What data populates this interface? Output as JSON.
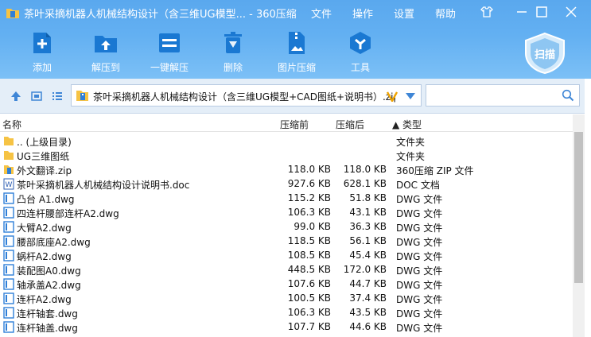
{
  "window": {
    "title": "茶叶采摘机器人机械结构设计（含三维UG模型... - 360压缩",
    "menu": [
      "文件",
      "操作",
      "设置",
      "帮助"
    ]
  },
  "toolbar": {
    "add": "添加",
    "extract": "解压到",
    "one_click": "一键解压",
    "delete": "删除",
    "image_compress": "图片压缩",
    "tools": "工具",
    "scan": "扫描"
  },
  "address": {
    "path": "茶叶采摘机器人机械结构设计（含三维UG模型+CAD图纸+说明书）.zip",
    "search_placeholder": ""
  },
  "columns": {
    "name": "名称",
    "size": "压缩前",
    "compressed": "压缩后",
    "type": "▲ 类型"
  },
  "colors": {
    "toolbar_top": "#5aa8ee",
    "toolbar_bottom": "#7cc0f6",
    "address_bg": "#e4eef8",
    "folder": "#f6c344",
    "dwg": "#2f7fd8"
  },
  "files": [
    {
      "name": ".. (上级目录)",
      "size": "",
      "compressed": "",
      "type": "文件夹",
      "icon": "folder-icon"
    },
    {
      "name": "UG三维图纸",
      "size": "",
      "compressed": "",
      "type": "文件夹",
      "icon": "folder-icon"
    },
    {
      "name": "外文翻译.zip",
      "size": "118.0 KB",
      "compressed": "118.0 KB",
      "type": "360压缩 ZIP 文件",
      "icon": "zip-icon"
    },
    {
      "name": "茶叶采摘机器人机械结构设计说明书.doc",
      "size": "927.6 KB",
      "compressed": "628.1 KB",
      "type": "DOC 文档",
      "icon": "doc-icon"
    },
    {
      "name": "凸台 A1.dwg",
      "size": "115.2 KB",
      "compressed": "51.8 KB",
      "type": "DWG 文件",
      "icon": "dwg-icon"
    },
    {
      "name": "四连杆腰部连杆A2.dwg",
      "size": "106.3 KB",
      "compressed": "43.1 KB",
      "type": "DWG 文件",
      "icon": "dwg-icon"
    },
    {
      "name": "大臂A2.dwg",
      "size": "99.0 KB",
      "compressed": "36.3 KB",
      "type": "DWG 文件",
      "icon": "dwg-icon"
    },
    {
      "name": "腰部底座A2.dwg",
      "size": "118.5 KB",
      "compressed": "56.1 KB",
      "type": "DWG 文件",
      "icon": "dwg-icon"
    },
    {
      "name": "蜗杆A2.dwg",
      "size": "108.5 KB",
      "compressed": "45.4 KB",
      "type": "DWG 文件",
      "icon": "dwg-icon"
    },
    {
      "name": "装配图A0.dwg",
      "size": "448.5 KB",
      "compressed": "172.0 KB",
      "type": "DWG 文件",
      "icon": "dwg-icon"
    },
    {
      "name": "轴承盖A2.dwg",
      "size": "107.6 KB",
      "compressed": "44.7 KB",
      "type": "DWG 文件",
      "icon": "dwg-icon"
    },
    {
      "name": "连杆A2.dwg",
      "size": "100.5 KB",
      "compressed": "37.4 KB",
      "type": "DWG 文件",
      "icon": "dwg-icon"
    },
    {
      "name": "连杆轴套.dwg",
      "size": "106.3 KB",
      "compressed": "43.5 KB",
      "type": "DWG 文件",
      "icon": "dwg-icon"
    },
    {
      "name": "连杆轴盖.dwg",
      "size": "107.7 KB",
      "compressed": "44.6 KB",
      "type": "DWG 文件",
      "icon": "dwg-icon"
    }
  ]
}
